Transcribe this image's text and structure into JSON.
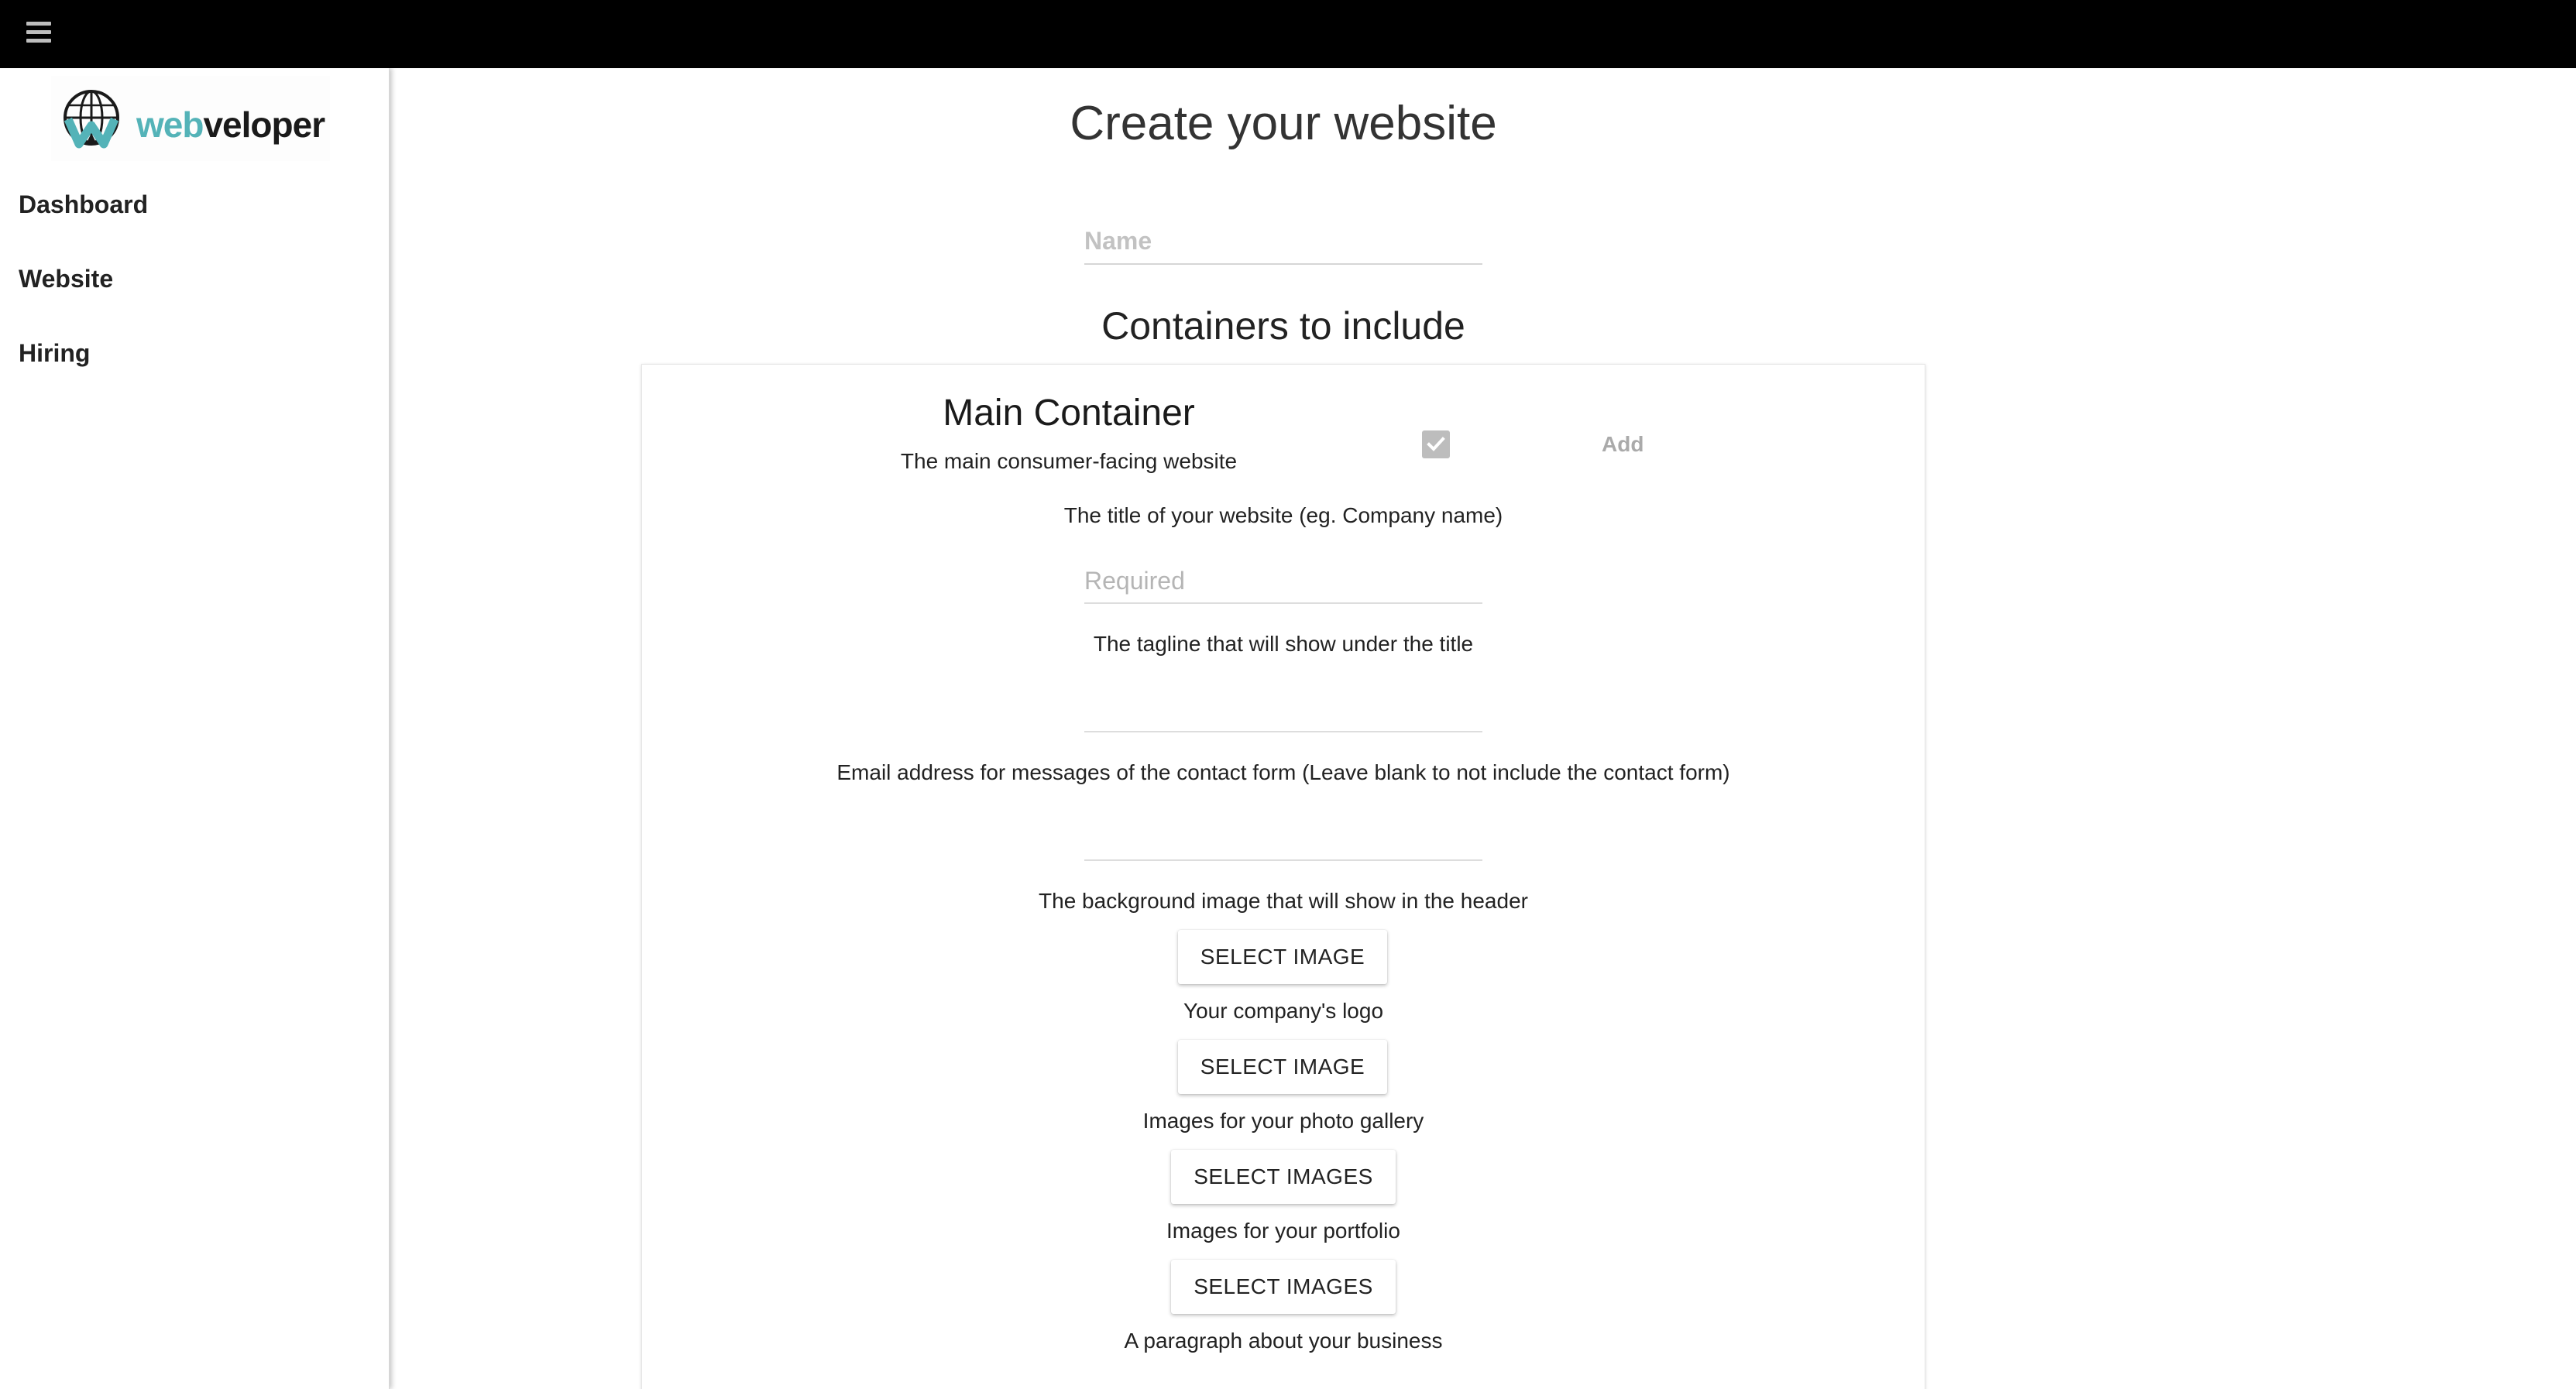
{
  "header": {
    "menu_icon": "hamburger-menu-icon"
  },
  "sidebar": {
    "logo": {
      "icon": "globe-w-logo-icon",
      "text_accent": "web",
      "text_rest": "veloper",
      "accent_color": "#54b3b8"
    },
    "items": [
      {
        "label": "Dashboard"
      },
      {
        "label": "Website"
      },
      {
        "label": "Hiring"
      }
    ]
  },
  "main": {
    "title": "Create your website",
    "name_field": {
      "placeholder": "Name",
      "value": ""
    },
    "section_title": "Containers to include",
    "container": {
      "title": "Main Container",
      "description": "The main consumer-facing website",
      "checked": true,
      "add_label": "Add",
      "fields": {
        "title_label": "The title of your website (eg. Company name)",
        "title_placeholder": "Required",
        "tagline_label": "The tagline that will show under the title",
        "email_label": "Email address for messages of the contact form (Leave blank to not include the contact form)",
        "background_label": "The background image that will show in the header",
        "background_button": "SELECT IMAGE",
        "logo_label": "Your company's logo",
        "logo_button": "SELECT IMAGE",
        "gallery_label": "Images for your photo gallery",
        "gallery_button": "SELECT IMAGES",
        "portfolio_label": "Images for your portfolio",
        "portfolio_button": "SELECT IMAGES",
        "about_label": "A paragraph about your business"
      }
    }
  }
}
